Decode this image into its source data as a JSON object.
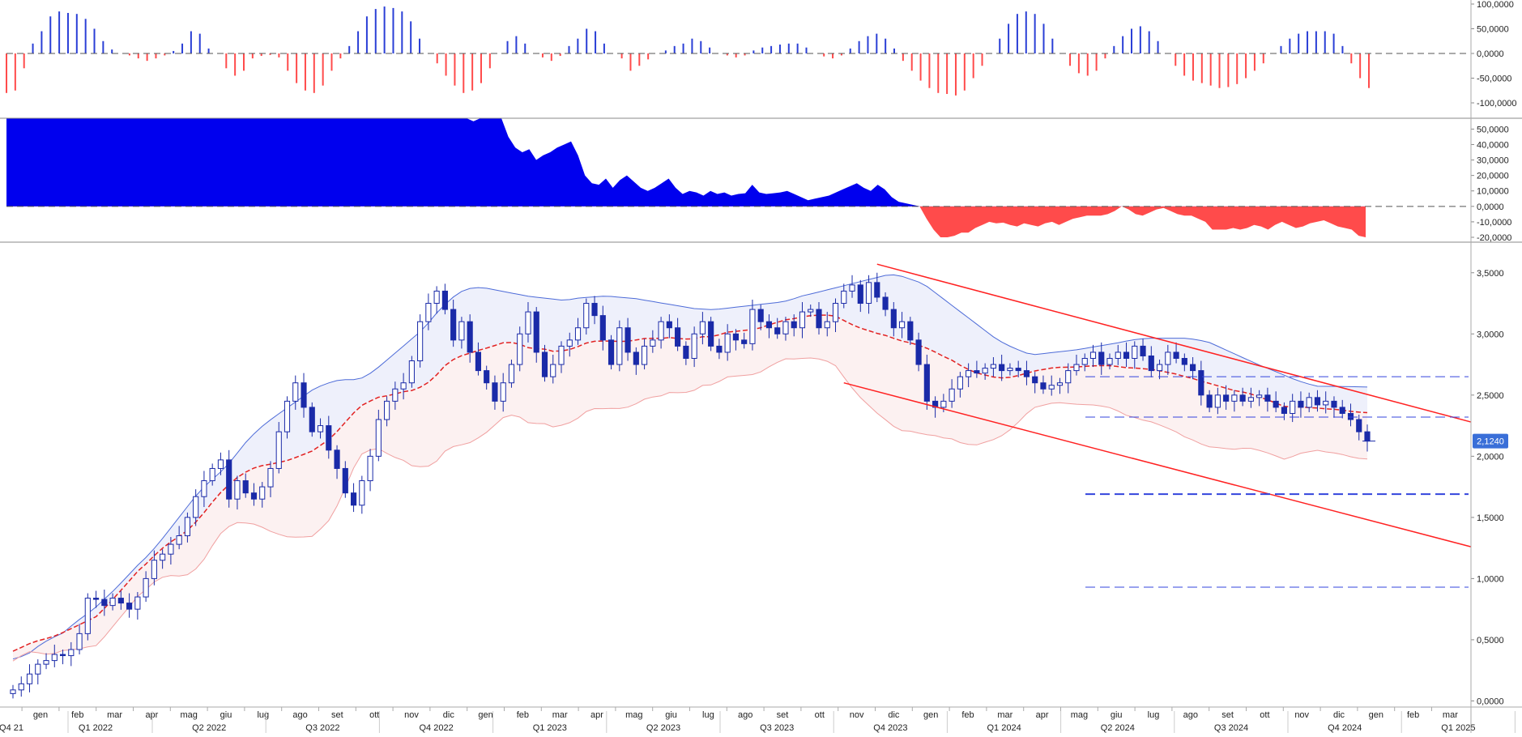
{
  "colors": {
    "candle_up_border": "#1a2aa8",
    "candle_down_fill": "#1a2aa8",
    "osc_positive": "#2a3fd6",
    "osc_negative": "#ff4b4b",
    "area_positive": "#0000ee",
    "area_negative": "#ff4b4b",
    "band_upper": "#4d6bd8",
    "band_fill": "#eef0fb",
    "band_lower_fill": "#fcf1f1",
    "band_lower": "#f0a0a0",
    "ma_dashed": "#e22222",
    "channel": "#ff2222",
    "support_dash": "#3344dd",
    "last_price_bg": "#3a6fd8"
  },
  "chart_data": [
    {
      "type": "bar",
      "panel": "oscillator",
      "ylim": [
        -100000,
        100000
      ],
      "yticks": [
        "100,0000",
        "50,0000",
        "0,0000",
        "-50,0000",
        "-100,0000"
      ],
      "values": [
        -80000,
        -75000,
        -30000,
        20000,
        45000,
        75000,
        85000,
        82000,
        80000,
        70000,
        50000,
        25000,
        8000,
        0,
        -4000,
        -10000,
        -15000,
        -10000,
        -4000,
        5000,
        20000,
        45000,
        40000,
        10000,
        0,
        -30000,
        -45000,
        -35000,
        -10000,
        -5000,
        -3000,
        -8000,
        -35000,
        -60000,
        -75000,
        -80000,
        -65000,
        -35000,
        -10000,
        15000,
        45000,
        75000,
        90000,
        95000,
        92000,
        85000,
        65000,
        30000,
        0,
        -20000,
        -45000,
        -65000,
        -80000,
        -75000,
        -60000,
        -30000,
        0,
        25000,
        35000,
        20000,
        0,
        -8000,
        -15000,
        -5000,
        15000,
        30000,
        50000,
        45000,
        20000,
        0,
        -10000,
        -35000,
        -25000,
        -12000,
        0,
        6000,
        15000,
        20000,
        30000,
        25000,
        12000,
        0,
        -4000,
        -8000,
        -4000,
        6000,
        12000,
        15000,
        18000,
        20000,
        20000,
        12000,
        0,
        -6000,
        -10000,
        -4000,
        10000,
        25000,
        35000,
        40000,
        30000,
        10000,
        -15000,
        -35000,
        -55000,
        -70000,
        -80000,
        -82000,
        -85000,
        -75000,
        -50000,
        -25000,
        0,
        30000,
        60000,
        80000,
        85000,
        80000,
        60000,
        30000,
        0,
        -25000,
        -40000,
        -45000,
        -35000,
        -10000,
        15000,
        35000,
        50000,
        55000,
        45000,
        25000,
        0,
        -25000,
        -45000,
        -55000,
        -60000,
        -65000,
        -70000,
        -68000,
        -62000,
        -50000,
        -35000,
        -20000,
        0,
        15000,
        30000,
        40000,
        45000,
        45000,
        45000,
        40000,
        15000,
        -20000,
        -50000,
        -70000
      ]
    },
    {
      "type": "area",
      "panel": "cumulative",
      "ylim": [
        -20000,
        50000
      ],
      "yticks": [
        "50,0000",
        "40,0000",
        "30,0000",
        "20,0000",
        "10,0000",
        "0,0000",
        "-10,0000",
        "-20,0000"
      ],
      "values": [
        80000,
        80000,
        80000,
        80000,
        80000,
        80000,
        80000,
        80000,
        80000,
        80000,
        80000,
        80000,
        80000,
        80000,
        80000,
        80000,
        80000,
        80000,
        80000,
        80000,
        80000,
        80000,
        80000,
        80000,
        80000,
        80000,
        80000,
        80000,
        80000,
        80000,
        80000,
        80000,
        80000,
        80000,
        80000,
        80000,
        80000,
        80000,
        80000,
        80000,
        80000,
        80000,
        80000,
        80000,
        80000,
        80000,
        80000,
        80000,
        80000,
        80000,
        80000,
        80000,
        80000,
        80000,
        80000,
        80000,
        80000,
        80000,
        80000,
        80000,
        80000,
        80000,
        80000,
        80000,
        80000,
        80000,
        60000,
        55000,
        60000,
        75000,
        85000,
        65000,
        45000,
        38000,
        35000,
        37000,
        30000,
        33000,
        35000,
        38000,
        40000,
        42000,
        33000,
        20000,
        15000,
        14000,
        18000,
        12000,
        17000,
        20000,
        16000,
        12000,
        10000,
        12000,
        15000,
        18000,
        12000,
        8000,
        10000,
        9000,
        7000,
        10000,
        8000,
        9000,
        7000,
        8000,
        8500,
        14000,
        9000,
        8000,
        8500,
        9000,
        10000,
        8000,
        6000,
        4000,
        5000,
        6000,
        7000,
        9000,
        11000,
        13000,
        15000,
        12000,
        10000,
        14000,
        11000,
        6000,
        3000,
        2000,
        1000,
        0,
        -8000,
        -15000,
        -20000,
        -20000,
        -19000,
        -17000,
        -17000,
        -14000,
        -12000,
        -10000,
        -11000,
        -10500,
        -12000,
        -13000,
        -11000,
        -12000,
        -13000,
        -11000,
        -10000,
        -12000,
        -10000,
        -8000,
        -7000,
        -6000,
        -6000,
        -6000,
        -5000,
        -3000,
        0,
        -2000,
        -5000,
        -6000,
        -4000,
        -2000,
        -1000,
        -3000,
        -5000,
        -6000,
        -6000,
        -8000,
        -10000,
        -15000,
        -15000,
        -15000,
        -14000,
        -15000,
        -14000,
        -12000,
        -13000,
        -15000,
        -12000,
        -10000,
        -12000,
        -14000,
        -13000,
        -11000,
        -10000,
        -9000,
        -11000,
        -13000,
        -14000,
        -15000,
        -19000,
        -20000
      ]
    },
    {
      "type": "candlestick",
      "panel": "price",
      "ylim": [
        -0.05,
        3.75
      ],
      "yticks": [
        "3,5000",
        "3,0000",
        "2,5000",
        "2,0000",
        "1,5000",
        "1,0000",
        "0,5000",
        "0,0000"
      ],
      "last_price_label": "2,1240",
      "horizontal_levels": [
        2.65,
        2.32,
        1.69,
        0.93
      ],
      "x_month_labels": [
        "gen",
        "feb",
        "mar",
        "apr",
        "mag",
        "giu",
        "lug",
        "ago",
        "set",
        "ott",
        "nov",
        "dic",
        "gen",
        "feb",
        "mar",
        "apr",
        "mag",
        "giu",
        "lug",
        "ago",
        "set",
        "ott",
        "nov",
        "dic",
        "gen",
        "feb",
        "mar",
        "apr",
        "mag",
        "giu",
        "lug",
        "ago",
        "set",
        "ott",
        "nov",
        "dic",
        "gen",
        "feb",
        "mar"
      ],
      "x_quarter_labels": [
        "Q4 21",
        "Q1 2022",
        "Q2 2022",
        "Q3 2022",
        "Q4 2022",
        "Q1 2023",
        "Q2 2023",
        "Q3 2023",
        "Q4 2023",
        "Q1 2024",
        "Q2 2024",
        "Q3 2024",
        "Q4 2024",
        "Q1 2025"
      ],
      "closes": [
        0.09,
        0.14,
        0.22,
        0.3,
        0.33,
        0.38,
        0.37,
        0.42,
        0.55,
        0.84,
        0.83,
        0.78,
        0.84,
        0.8,
        0.75,
        0.85,
        1.0,
        1.15,
        1.2,
        1.28,
        1.35,
        1.5,
        1.67,
        1.8,
        1.9,
        1.97,
        1.65,
        1.8,
        1.7,
        1.65,
        1.75,
        1.9,
        2.2,
        2.45,
        2.6,
        2.4,
        2.2,
        2.25,
        2.05,
        1.9,
        1.7,
        1.6,
        1.8,
        2.0,
        2.3,
        2.45,
        2.55,
        2.6,
        2.78,
        3.1,
        3.25,
        3.35,
        3.2,
        2.95,
        3.1,
        2.85,
        2.7,
        2.6,
        2.45,
        2.6,
        2.75,
        3.0,
        3.18,
        2.85,
        2.65,
        2.75,
        2.9,
        2.95,
        3.05,
        3.25,
        3.15,
        2.95,
        2.75,
        3.05,
        2.85,
        2.75,
        2.9,
        2.95,
        3.1,
        3.05,
        2.9,
        2.8,
        3.0,
        3.1,
        2.9,
        2.85,
        3.0,
        2.95,
        2.92,
        3.2,
        3.1,
        3.05,
        3.0,
        3.1,
        3.05,
        3.18,
        3.2,
        3.05,
        3.1,
        3.25,
        3.35,
        3.4,
        3.25,
        3.42,
        3.3,
        3.2,
        3.05,
        3.1,
        2.95,
        2.75,
        2.45,
        2.4,
        2.45,
        2.55,
        2.65,
        2.7,
        2.68,
        2.72,
        2.75,
        2.7,
        2.72,
        2.7,
        2.65,
        2.6,
        2.55,
        2.58,
        2.6,
        2.7,
        2.75,
        2.8,
        2.85,
        2.75,
        2.8,
        2.85,
        2.8,
        2.9,
        2.82,
        2.7,
        2.75,
        2.85,
        2.8,
        2.75,
        2.7,
        2.5,
        2.4,
        2.5,
        2.45,
        2.5,
        2.45,
        2.48,
        2.5,
        2.45,
        2.4,
        2.35,
        2.45,
        2.4,
        2.48,
        2.42,
        2.45,
        2.4,
        2.35,
        2.3,
        2.2,
        2.124
      ]
    }
  ]
}
